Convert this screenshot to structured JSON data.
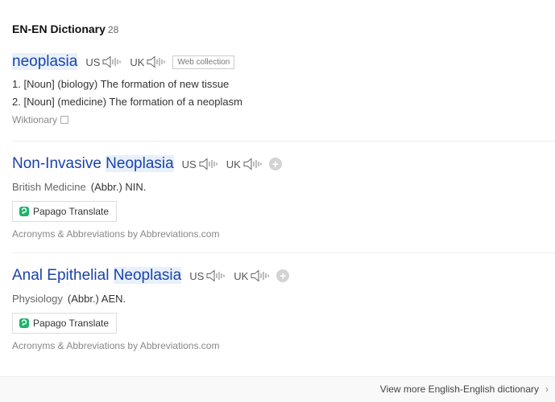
{
  "header": {
    "title": "EN-EN Dictionary",
    "count": "28"
  },
  "entries": [
    {
      "word": "neoplasia",
      "us_label": "US",
      "uk_label": "UK",
      "badge": "Web collection",
      "definitions": [
        "1. [Noun] (biology) The formation of new tissue",
        "2. [Noun] (medicine) The formation of a neoplasm"
      ],
      "source": "Wiktionary"
    },
    {
      "word_prefix": "Non-Invasive ",
      "word_highlight": "Neoplasia",
      "us_label": "US",
      "uk_label": "UK",
      "category": "British Medicine",
      "abbr": "(Abbr.) NIN.",
      "translate_label": "Papago Translate",
      "source": "Acronyms & Abbreviations by Abbreviations.com"
    },
    {
      "word_prefix": "Anal Epithelial ",
      "word_highlight": "Neoplasia",
      "us_label": "US",
      "uk_label": "UK",
      "category": "Physiology",
      "abbr": "(Abbr.) AEN.",
      "translate_label": "Papago Translate",
      "source": "Acronyms & Abbreviations by Abbreviations.com"
    }
  ],
  "footer": {
    "more_label": "View more English-English dictionary"
  },
  "colors": {
    "link": "#1a44a8",
    "highlight_bg": "#e8f0fb",
    "papago_green": "#1fb36b"
  }
}
